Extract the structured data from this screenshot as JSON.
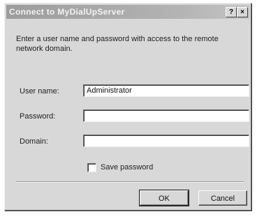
{
  "window": {
    "title": "Connect to MyDialUpServer",
    "help_button": "?",
    "close_button": "×"
  },
  "intro_text": "Enter a user name and password with access to the remote network domain.",
  "fields": {
    "username": {
      "label": "User name:",
      "value": "Administrator"
    },
    "password": {
      "label": "Password:",
      "value": ""
    },
    "domain": {
      "label": "Domain:",
      "value": ""
    }
  },
  "save_password": {
    "label": "Save password",
    "checked": false
  },
  "buttons": {
    "ok": "OK",
    "cancel": "Cancel"
  }
}
